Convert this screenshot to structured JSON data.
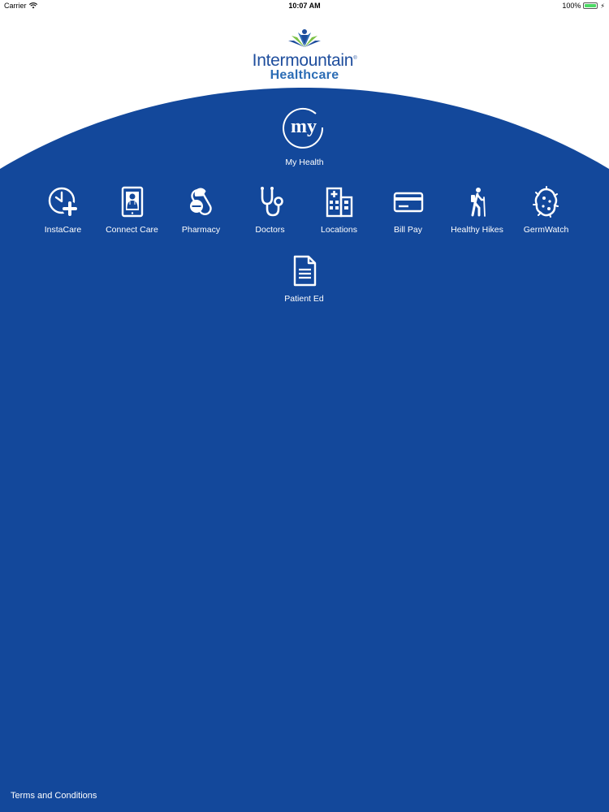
{
  "status_bar": {
    "carrier": "Carrier",
    "time": "10:07 AM",
    "battery": "100%",
    "battery_level": 1.0
  },
  "logo": {
    "line1": "Intermountain",
    "registered": "®",
    "line2": "Healthcare"
  },
  "my_health": {
    "badge": "my",
    "label": "My Health"
  },
  "menu": [
    {
      "label": "InstaCare",
      "icon": "clock-plus-icon"
    },
    {
      "label": "Connect Care",
      "icon": "tablet-doctor-icon"
    },
    {
      "label": "Pharmacy",
      "icon": "pills-icon"
    },
    {
      "label": "Doctors",
      "icon": "stethoscope-icon"
    },
    {
      "label": "Locations",
      "icon": "hospital-building-icon"
    },
    {
      "label": "Bill Pay",
      "icon": "credit-card-icon"
    },
    {
      "label": "Healthy Hikes",
      "icon": "hiker-icon"
    },
    {
      "label": "GermWatch",
      "icon": "germ-icon"
    },
    {
      "label": "Patient Ed",
      "icon": "document-icon"
    }
  ],
  "footer": {
    "terms": "Terms and Conditions"
  },
  "colors": {
    "primary_blue": "#13489b",
    "logo_blue": "#1f4e9d",
    "logo_light_blue": "#2c6db5",
    "logo_green": "#7ac143"
  }
}
